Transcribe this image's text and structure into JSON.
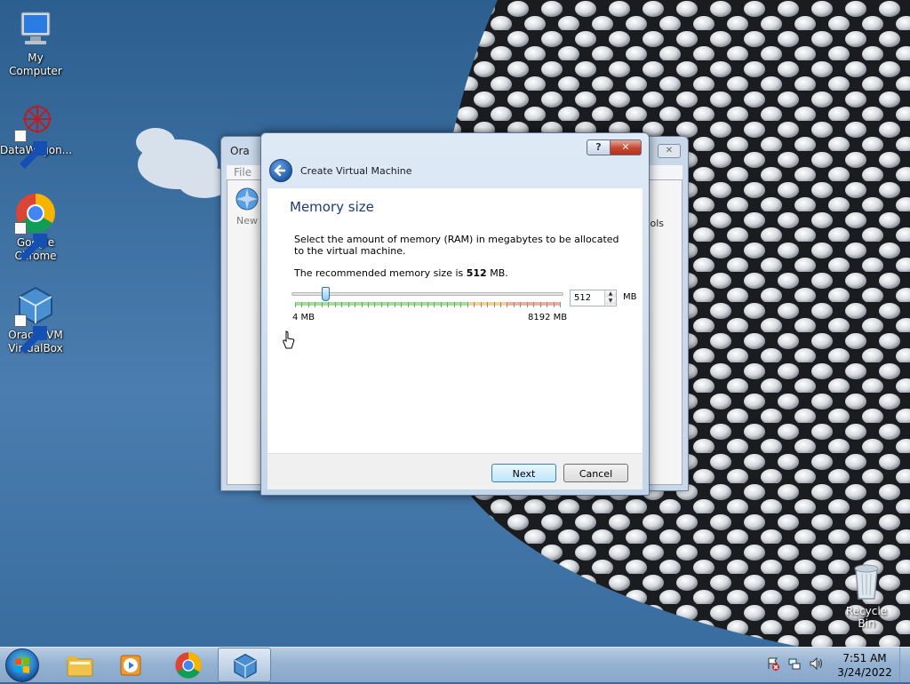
{
  "desktop": {
    "icons": [
      {
        "label": "My Computer",
        "icon": "computer-icon"
      },
      {
        "label": "DataWagon...",
        "icon": "datawagon-icon"
      },
      {
        "label": "Google Chrome",
        "icon": "chrome-icon"
      },
      {
        "label": "Oracle VM VirtualBox",
        "icon": "virtualbox-icon"
      }
    ],
    "recycle_bin": {
      "label": "Recycle Bin",
      "icon": "recycle-bin-icon"
    }
  },
  "vbox_manager": {
    "title": "Ora",
    "menu_file": "File",
    "new_label": "New",
    "tools_label": "ools"
  },
  "dialog": {
    "title": "Create Virtual Machine",
    "help_btn": "?",
    "close_btn": "✕",
    "heading": "Memory size",
    "description": "Select the amount of memory (RAM) in megabytes to be allocated to the virtual machine.",
    "recommend_prefix": "The recommended memory size is ",
    "recommend_value": "512",
    "recommend_suffix": " MB.",
    "slider": {
      "min_label": "4 MB",
      "max_label": "8192 MB",
      "min": 4,
      "max": 8192,
      "value": 512
    },
    "spin_value": "512",
    "unit": "MB",
    "next_label": "Next",
    "cancel_label": "Cancel"
  },
  "taskbar": {
    "items": [
      "windows-start-orb",
      "file-explorer-icon",
      "media-player-icon",
      "chrome-icon",
      "virtualbox-icon"
    ],
    "tray_icons": [
      "action-center-icon",
      "network-icon",
      "volume-icon"
    ],
    "time": "7:51 AM",
    "date": "3/24/2022"
  }
}
